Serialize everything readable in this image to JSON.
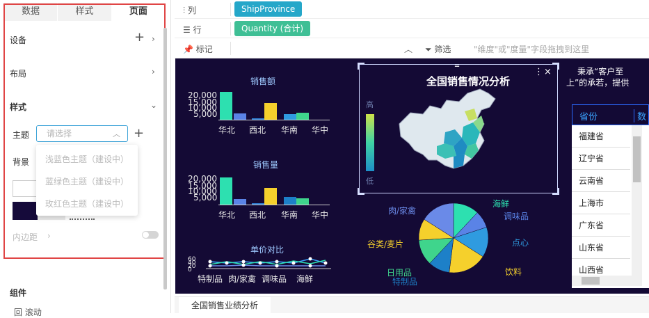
{
  "left_panel": {
    "tabs": [
      "数据",
      "样式",
      "页面"
    ],
    "active_tab": "页面",
    "device_label": "设备",
    "layout_label": "布局",
    "style_label": "样式",
    "theme_label": "主题",
    "theme_placeholder": "请选择",
    "theme_options": [
      "浅蓝色主题（建设中）",
      "蓝绿色主题（建设中）",
      "玫红色主题（建设中）"
    ],
    "background_label": "背景",
    "padding_label": "内边距",
    "components_label": "组件",
    "component_item": "回 滚动"
  },
  "shelves": {
    "columns_label": "列",
    "columns_field": "ShipProvince",
    "rows_label": "行",
    "rows_field": "Quantity (合计)",
    "marks_label": "标记",
    "filter_label": "筛选",
    "drop_hint": "\"维度\"或\"度量\"字段拖拽到这里"
  },
  "colors": {
    "canvas_bg": "#140a35",
    "pill_column": "#25a7c9",
    "pill_row": "#3fbf95",
    "highlight_frame": "#e04545"
  },
  "dashboard": {
    "title": "全国销售情况分析",
    "legend_high": "高",
    "legend_low": "低",
    "side_text_line1": "秉承“客户至",
    "side_text_line2": "上”的承若，提供",
    "table_header": [
      "省份",
      "数"
    ],
    "table_rows": [
      "福建省",
      "辽宁省",
      "云南省",
      "上海市",
      "广东省",
      "山东省",
      "山西省"
    ],
    "bottom_tab": "全国销售业绩分析"
  },
  "chart_data": [
    {
      "type": "bar",
      "title": "销售额",
      "categories": [
        "华北",
        "西北",
        "华南",
        "华中"
      ],
      "tick_labels_y": [
        "20,000",
        "15,000",
        "10,000",
        "5,000"
      ],
      "ylim": [
        0,
        25000
      ],
      "values": [
        24000,
        5500,
        1000,
        14000,
        4800,
        5800
      ],
      "bar_colors": [
        "#2de0b0",
        "#5a83e6",
        "#2d7dd2",
        "#f5d02c",
        "#2f9be0",
        "#3fd58c"
      ],
      "x_positions": [
        "华北",
        "华北",
        "西北",
        "西北",
        "华南",
        "华南"
      ]
    },
    {
      "type": "bar",
      "title": "销售量",
      "categories": [
        "华北",
        "西北",
        "华南",
        "华中"
      ],
      "tick_labels_y": [
        "20,000",
        "15,000",
        "10,000",
        "5,000"
      ],
      "ylim": [
        0,
        25000
      ],
      "values": [
        23500,
        4800,
        1000,
        14000,
        6500,
        5200
      ],
      "bar_colors": [
        "#2de0b0",
        "#5a83e6",
        "#2d7dd2",
        "#f5d02c",
        "#1d80c8",
        "#3fd58c"
      ]
    },
    {
      "type": "line",
      "title": "单价对比",
      "categories": [
        "特制品",
        "肉/家禽",
        "调味品",
        "海鲜"
      ],
      "tick_labels_y": [
        "60",
        "40",
        "20",
        "0"
      ],
      "series_count": 3
    },
    {
      "type": "pie",
      "slices": [
        {
          "label": "海鲜",
          "value": 12,
          "color": "#2de0b0"
        },
        {
          "label": "调味品",
          "value": 8,
          "color": "#5a83e6"
        },
        {
          "label": "点心",
          "value": 14,
          "color": "#2f9be0"
        },
        {
          "label": "饮料",
          "value": 18,
          "color": "#f5d02c"
        },
        {
          "label": "特制品",
          "value": 10,
          "color": "#1d80c8"
        },
        {
          "label": "日用品",
          "value": 12,
          "color": "#3fd58c"
        },
        {
          "label": "谷类/麦片",
          "value": 10,
          "color": "#f5d02c"
        },
        {
          "label": "肉/家禽",
          "value": 16,
          "color": "#6a8ae8"
        }
      ]
    }
  ]
}
